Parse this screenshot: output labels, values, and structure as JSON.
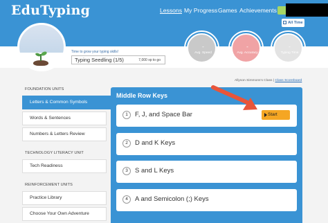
{
  "header": {
    "logo": "EduTyping",
    "nav": [
      "Lessons",
      "My Progress",
      "Games",
      "Achievements"
    ],
    "active_nav": "Lessons",
    "time_filter": "All Time",
    "accent_color": "#3a93d4"
  },
  "profile": {
    "goal_caption": "Time to grow your typing skills!",
    "level": "Typing Seedling (1/5)",
    "xp": "7,000 xp to go",
    "avatar_icon": "seedling-icon"
  },
  "stats": [
    {
      "value": "-",
      "label": "Avg. Speed",
      "color": "#c9c9c9"
    },
    {
      "value": "-",
      "label": "Avg. Accuracy",
      "color": "#f0a3a5"
    },
    {
      "value": "-",
      "label": "Typing Time",
      "color": "#e3e3e3"
    }
  ],
  "class_info": {
    "class_name": "Allyson Simmons's Class",
    "separator": "|",
    "scoreboard_link": "Class Scoreboard"
  },
  "sidebar": {
    "sections": [
      {
        "title": "FOUNDATION UNITS",
        "items": [
          "Letters & Common Symbols",
          "Words & Sentences",
          "Numbers & Letters Review"
        ]
      },
      {
        "title": "TECHNOLOGY LITERACY UNIT",
        "items": [
          "Tech Readiness"
        ]
      },
      {
        "title": "REINFORCEMENT UNITS",
        "items": [
          "Practice Library",
          "Choose Your Own Adventure"
        ]
      }
    ],
    "active_item": "Letters & Common Symbols"
  },
  "lessons": {
    "title": "Middle Row Keys",
    "items": [
      {
        "number": "1",
        "name": "F, J, and Space Bar"
      },
      {
        "number": "2",
        "name": "D and K Keys"
      },
      {
        "number": "3",
        "name": "S and L Keys"
      },
      {
        "number": "4",
        "name": "A and Semicolon (;) Keys"
      }
    ],
    "start_label": "Start",
    "start_color": "#f5a623",
    "annotation_color": "#e8553a"
  }
}
